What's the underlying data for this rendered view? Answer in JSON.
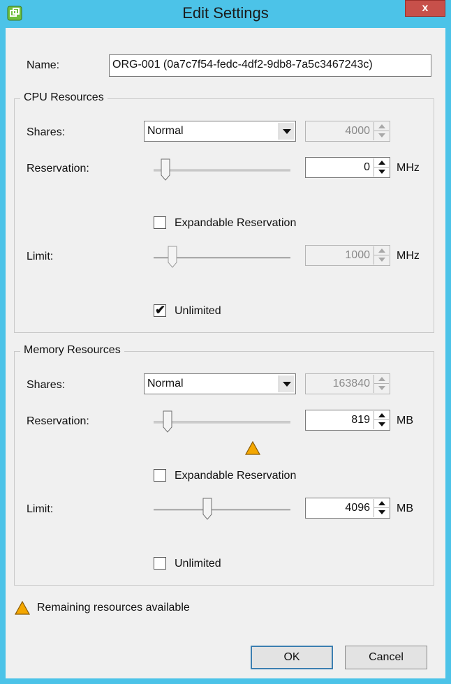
{
  "window": {
    "title": "Edit Settings",
    "close_label": "x"
  },
  "name": {
    "label": "Name:",
    "value": "ORG-001 (0a7c7f54-fedc-4df2-9db8-7a5c3467243c)"
  },
  "cpu": {
    "group_title": "CPU Resources",
    "shares": {
      "label": "Shares:",
      "selected": "Normal",
      "value": "4000"
    },
    "reservation": {
      "label": "Reservation:",
      "value": "0",
      "unit": "MHz",
      "slider_fraction": 0.0
    },
    "expandable": {
      "label": "Expandable Reservation",
      "checked": false
    },
    "limit": {
      "label": "Limit:",
      "value": "1000",
      "unit": "MHz",
      "slider_fraction": 0.06
    },
    "unlimited": {
      "label": "Unlimited",
      "checked": true
    }
  },
  "memory": {
    "group_title": "Memory Resources",
    "shares": {
      "label": "Shares:",
      "selected": "Normal",
      "value": "163840"
    },
    "reservation": {
      "label": "Reservation:",
      "value": "819",
      "unit": "MB",
      "slider_fraction": 0.02
    },
    "expandable": {
      "label": "Expandable Reservation",
      "checked": false
    },
    "limit": {
      "label": "Limit:",
      "value": "4096",
      "unit": "MB",
      "slider_fraction": 0.35
    },
    "unlimited": {
      "label": "Unlimited",
      "checked": false
    }
  },
  "footer": {
    "warning_text": "Remaining resources available"
  },
  "buttons": {
    "ok": "OK",
    "cancel": "Cancel"
  },
  "colors": {
    "titlebar": "#4cc3e8",
    "close": "#c7504a",
    "warning": "#f4a700"
  },
  "icons": {
    "app": "vmware-app-icon",
    "warning": "warning-triangle-icon",
    "close": "close-icon"
  }
}
